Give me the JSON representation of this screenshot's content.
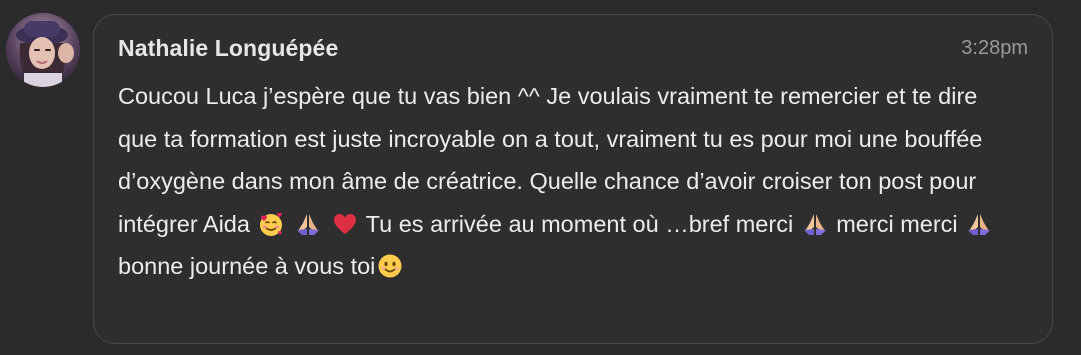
{
  "message": {
    "author": "Nathalie Longuépée",
    "time": "3:28pm",
    "avatar_icon": "profile-photo",
    "segments": [
      {
        "type": "text",
        "value": "Coucou Luca j’espère que tu vas bien ^^ Je voulais vraiment te remercier et te dire que ta formation est juste incroyable on a tout, vraiment tu es pour moi une bouffée d’oxygène dans mon âme de créatrice. Quelle chance d’avoir croiser ton post pour intégrer Aida "
      },
      {
        "type": "emoji",
        "name": "smiling-face-with-hearts-icon"
      },
      {
        "type": "text",
        "value": " "
      },
      {
        "type": "emoji",
        "name": "folded-hands-icon"
      },
      {
        "type": "text",
        "value": " "
      },
      {
        "type": "emoji",
        "name": "red-heart-icon"
      },
      {
        "type": "text",
        "value": " Tu es arrivée au moment où …bref merci "
      },
      {
        "type": "emoji",
        "name": "folded-hands-icon"
      },
      {
        "type": "text",
        "value": " merci merci "
      },
      {
        "type": "emoji",
        "name": "folded-hands-icon"
      },
      {
        "type": "text",
        "value": " bonne journée à vous toi"
      },
      {
        "type": "emoji",
        "name": "smiling-face-icon"
      }
    ]
  },
  "colors": {
    "background": "#2b2b2b",
    "bubble": "#2e2e2e",
    "bubble_border": "#484848",
    "text": "#ececec",
    "timestamp": "#9a9a9a"
  }
}
